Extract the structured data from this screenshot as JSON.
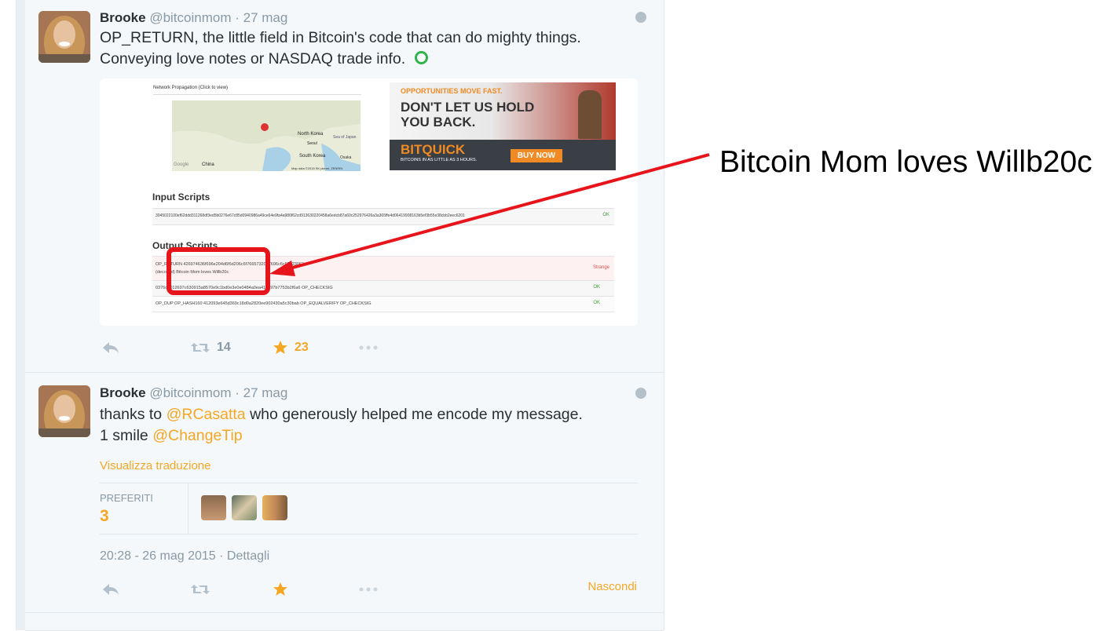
{
  "tweets": [
    {
      "name": "Brooke",
      "handle": "@bitcoinmom",
      "separator": "·",
      "date": "27 mag",
      "text_line1": "OP_RETURN, the little field in Bitcoin's code that can do mighty things.",
      "text_line2": "Conveying love notes or NASDAQ trade info.",
      "media": {
        "map_title": "Network Propagation (Click to view)",
        "map_labels": [
          "North Korea",
          "Seoul",
          "Sea of Japan",
          "South Korea",
          "Osaka",
          "China",
          "Google",
          "Map data ©2015 SK planet, ZENRIN"
        ],
        "ad": {
          "line1": "OPPORTUNITIES MOVE FAST.",
          "line2": "DON'T LET US HOLD",
          "line3": "YOU BACK.",
          "brand": "BITQUICK",
          "tagline": "BITCOINS IN AS LITTLE AS 3 HOURS.",
          "cta": "BUY NOW"
        },
        "input_heading": "Input Scripts",
        "input_script": "3045022100ef62ddd311268df3ed5b0276e67c85d0940986a49ce64e9fa4a986f62cd913630220458a6edcb87a60c252976426a3a365ffe4d06419908163b5ef3b55e38cbb2eec6201",
        "input_status": "OK",
        "output_heading": "Output Scripts",
        "outputs": [
          {
            "line1": "OP_RETURN 426974636f696e204d6f6d206c6f7665732057696c6c62323063",
            "line2": "(decoded) Bitcoin Mom loves Willb20c",
            "status": "Strange"
          },
          {
            "line1": "0376d4012697c630915a8570e9c1bd0e3e0e0484a0ea41e597b7753b2f6a6 OP_CHECKSIG",
            "line2": "",
            "status": "OK"
          },
          {
            "line1": "OP_DUP OP_HASH160 412093e645d369c18d0a2820ee902430a5c30bab OP_EQUALVERIFY OP_CHECKSIG",
            "line2": "",
            "status": "OK"
          }
        ]
      },
      "retweets": "14",
      "favorites": "23"
    },
    {
      "name": "Brooke",
      "handle": "@bitcoinmom",
      "separator": "·",
      "date": "27 mag",
      "text_a": "thanks to ",
      "mention1": "@RCasatta",
      "text_b": " who generously helped me encode my message.",
      "text_c": "1 smile ",
      "mention2": "@ChangeTip",
      "translate": "Visualizza traduzione",
      "stats_label": "PREFERITI",
      "stats_value": "3",
      "timestamp": "20:28 - 26 mag 2015 · Dettagli",
      "hide": "Nascondi"
    }
  ],
  "annotation": "Bitcoin Mom loves Willb20c",
  "colors": {
    "accent": "#f5a623",
    "annotation_red": "#e8141b",
    "ok_green": "#3c9b35",
    "strange_red": "#d9534f",
    "ad_orange": "#f08a24"
  }
}
